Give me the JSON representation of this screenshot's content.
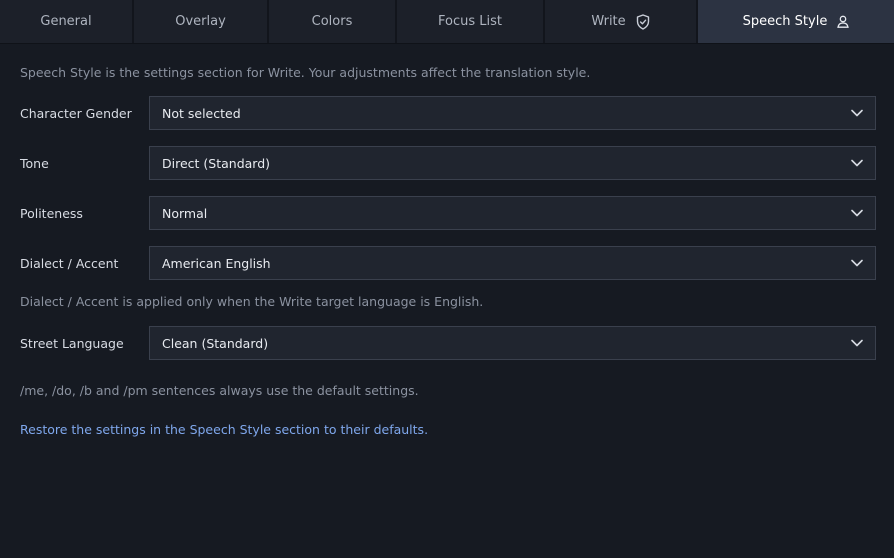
{
  "tabs": [
    {
      "label": "General",
      "icon": null,
      "active": false
    },
    {
      "label": "Overlay",
      "icon": null,
      "active": false
    },
    {
      "label": "Colors",
      "icon": null,
      "active": false
    },
    {
      "label": "Focus List",
      "icon": null,
      "active": false
    },
    {
      "label": "Write",
      "icon": "shield-check-icon",
      "active": false
    },
    {
      "label": "Speech Style",
      "icon": "person-icon",
      "active": true
    }
  ],
  "speech_style": {
    "description": "Speech Style is the settings section for Write. Your adjustments affect the translation style.",
    "fields": [
      {
        "label": "Character Gender",
        "value": "Not selected"
      },
      {
        "label": "Tone",
        "value": "Direct (Standard)"
      },
      {
        "label": "Politeness",
        "value": "Normal"
      },
      {
        "label": "Dialect / Accent",
        "value": "American English"
      },
      {
        "label": "Street Language",
        "value": "Clean (Standard)"
      }
    ],
    "dialect_note": "Dialect / Accent is applied only when the Write target language is English.",
    "commands_note": "/me, /do, /b and /pm sentences always use the default settings.",
    "restore_link": "Restore the settings in the Speech Style section to their defaults."
  },
  "colors": {
    "active_tab_bg": "#2c3342",
    "link": "#7fa7ec",
    "background": "#161a22"
  }
}
